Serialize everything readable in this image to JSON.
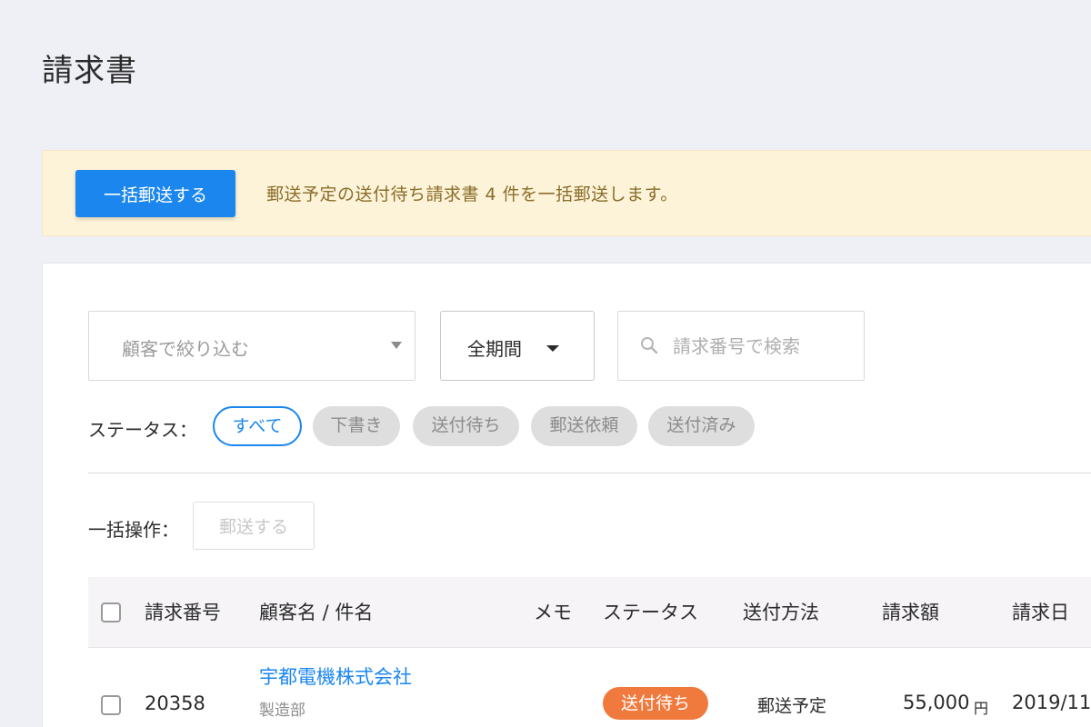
{
  "page": {
    "title": "請求書"
  },
  "notice": {
    "button_label": "一括郵送する",
    "message": "郵送予定の送付待ち請求書 4 件を一括郵送します。"
  },
  "filters": {
    "customer_placeholder": "顧客で絞り込む",
    "period_label": "全期間",
    "search_placeholder": "請求番号で検索"
  },
  "status_filter": {
    "label": "ステータス：",
    "chips": [
      "すべて",
      "下書き",
      "送付待ち",
      "郵送依頼",
      "送付済み"
    ],
    "active": "すべて"
  },
  "bulk": {
    "label": "一括操作：",
    "button_label": "郵送する"
  },
  "table": {
    "headers": {
      "number": "請求番号",
      "customer": "顧客名 / 件名",
      "memo": "メモ",
      "status": "ステータス",
      "method": "送付方法",
      "amount": "請求額",
      "date": "請求日"
    },
    "rows": [
      {
        "number": "20358",
        "customer": "宇都電機株式会社",
        "subject": "製造部",
        "memo": "",
        "status": "送付待ち",
        "method": "郵送予定",
        "amount": "55,000",
        "currency": "円",
        "date": "2019/11"
      }
    ]
  },
  "colors": {
    "accent": "#1a86ee",
    "notice_bg": "#fdf3d8",
    "notice_text": "#8a6d2a",
    "status_pending": "#f07a3e"
  }
}
